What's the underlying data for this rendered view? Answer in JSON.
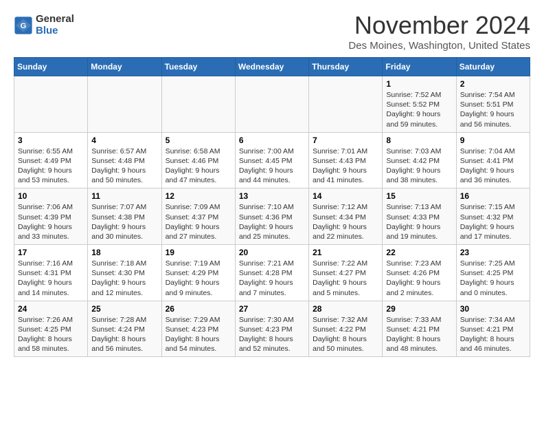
{
  "header": {
    "logo_line1": "General",
    "logo_line2": "Blue",
    "month_title": "November 2024",
    "location": "Des Moines, Washington, United States"
  },
  "days_of_week": [
    "Sunday",
    "Monday",
    "Tuesday",
    "Wednesday",
    "Thursday",
    "Friday",
    "Saturday"
  ],
  "weeks": [
    [
      {
        "day": "",
        "info": ""
      },
      {
        "day": "",
        "info": ""
      },
      {
        "day": "",
        "info": ""
      },
      {
        "day": "",
        "info": ""
      },
      {
        "day": "",
        "info": ""
      },
      {
        "day": "1",
        "info": "Sunrise: 7:52 AM\nSunset: 5:52 PM\nDaylight: 9 hours and 59 minutes."
      },
      {
        "day": "2",
        "info": "Sunrise: 7:54 AM\nSunset: 5:51 PM\nDaylight: 9 hours and 56 minutes."
      }
    ],
    [
      {
        "day": "3",
        "info": "Sunrise: 6:55 AM\nSunset: 4:49 PM\nDaylight: 9 hours and 53 minutes."
      },
      {
        "day": "4",
        "info": "Sunrise: 6:57 AM\nSunset: 4:48 PM\nDaylight: 9 hours and 50 minutes."
      },
      {
        "day": "5",
        "info": "Sunrise: 6:58 AM\nSunset: 4:46 PM\nDaylight: 9 hours and 47 minutes."
      },
      {
        "day": "6",
        "info": "Sunrise: 7:00 AM\nSunset: 4:45 PM\nDaylight: 9 hours and 44 minutes."
      },
      {
        "day": "7",
        "info": "Sunrise: 7:01 AM\nSunset: 4:43 PM\nDaylight: 9 hours and 41 minutes."
      },
      {
        "day": "8",
        "info": "Sunrise: 7:03 AM\nSunset: 4:42 PM\nDaylight: 9 hours and 38 minutes."
      },
      {
        "day": "9",
        "info": "Sunrise: 7:04 AM\nSunset: 4:41 PM\nDaylight: 9 hours and 36 minutes."
      }
    ],
    [
      {
        "day": "10",
        "info": "Sunrise: 7:06 AM\nSunset: 4:39 PM\nDaylight: 9 hours and 33 minutes."
      },
      {
        "day": "11",
        "info": "Sunrise: 7:07 AM\nSunset: 4:38 PM\nDaylight: 9 hours and 30 minutes."
      },
      {
        "day": "12",
        "info": "Sunrise: 7:09 AM\nSunset: 4:37 PM\nDaylight: 9 hours and 27 minutes."
      },
      {
        "day": "13",
        "info": "Sunrise: 7:10 AM\nSunset: 4:36 PM\nDaylight: 9 hours and 25 minutes."
      },
      {
        "day": "14",
        "info": "Sunrise: 7:12 AM\nSunset: 4:34 PM\nDaylight: 9 hours and 22 minutes."
      },
      {
        "day": "15",
        "info": "Sunrise: 7:13 AM\nSunset: 4:33 PM\nDaylight: 9 hours and 19 minutes."
      },
      {
        "day": "16",
        "info": "Sunrise: 7:15 AM\nSunset: 4:32 PM\nDaylight: 9 hours and 17 minutes."
      }
    ],
    [
      {
        "day": "17",
        "info": "Sunrise: 7:16 AM\nSunset: 4:31 PM\nDaylight: 9 hours and 14 minutes."
      },
      {
        "day": "18",
        "info": "Sunrise: 7:18 AM\nSunset: 4:30 PM\nDaylight: 9 hours and 12 minutes."
      },
      {
        "day": "19",
        "info": "Sunrise: 7:19 AM\nSunset: 4:29 PM\nDaylight: 9 hours and 9 minutes."
      },
      {
        "day": "20",
        "info": "Sunrise: 7:21 AM\nSunset: 4:28 PM\nDaylight: 9 hours and 7 minutes."
      },
      {
        "day": "21",
        "info": "Sunrise: 7:22 AM\nSunset: 4:27 PM\nDaylight: 9 hours and 5 minutes."
      },
      {
        "day": "22",
        "info": "Sunrise: 7:23 AM\nSunset: 4:26 PM\nDaylight: 9 hours and 2 minutes."
      },
      {
        "day": "23",
        "info": "Sunrise: 7:25 AM\nSunset: 4:25 PM\nDaylight: 9 hours and 0 minutes."
      }
    ],
    [
      {
        "day": "24",
        "info": "Sunrise: 7:26 AM\nSunset: 4:25 PM\nDaylight: 8 hours and 58 minutes."
      },
      {
        "day": "25",
        "info": "Sunrise: 7:28 AM\nSunset: 4:24 PM\nDaylight: 8 hours and 56 minutes."
      },
      {
        "day": "26",
        "info": "Sunrise: 7:29 AM\nSunset: 4:23 PM\nDaylight: 8 hours and 54 minutes."
      },
      {
        "day": "27",
        "info": "Sunrise: 7:30 AM\nSunset: 4:23 PM\nDaylight: 8 hours and 52 minutes."
      },
      {
        "day": "28",
        "info": "Sunrise: 7:32 AM\nSunset: 4:22 PM\nDaylight: 8 hours and 50 minutes."
      },
      {
        "day": "29",
        "info": "Sunrise: 7:33 AM\nSunset: 4:21 PM\nDaylight: 8 hours and 48 minutes."
      },
      {
        "day": "30",
        "info": "Sunrise: 7:34 AM\nSunset: 4:21 PM\nDaylight: 8 hours and 46 minutes."
      }
    ]
  ]
}
